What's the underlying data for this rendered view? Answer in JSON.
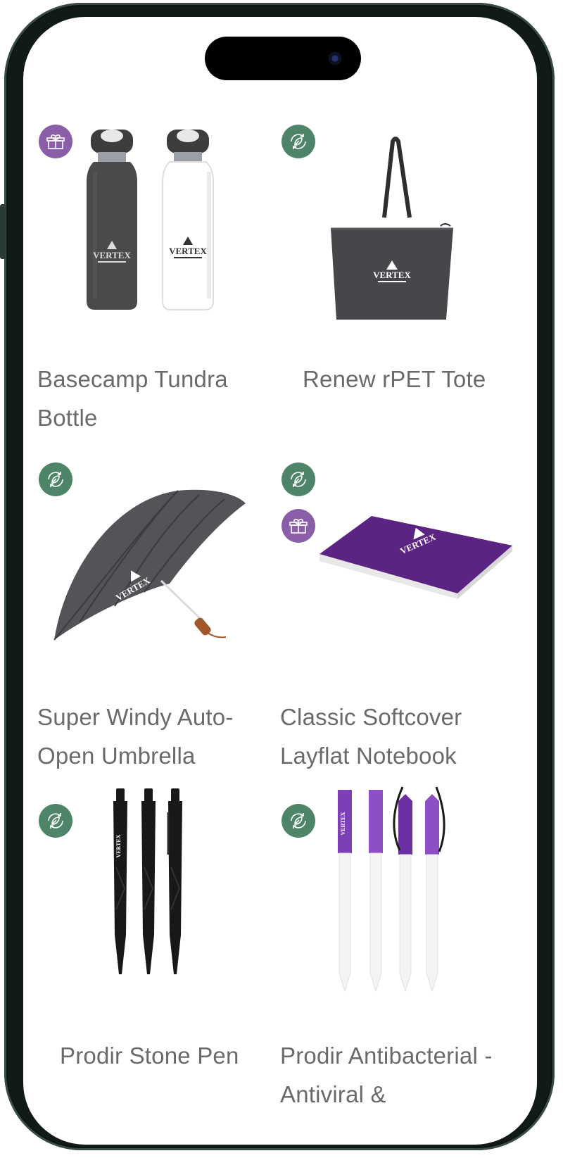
{
  "products": [
    {
      "name": "Basecamp Tundra Bottle",
      "brand": "VERTEX",
      "badges": [
        "gift"
      ]
    },
    {
      "name": "Renew rPET Tote",
      "brand": "VERTEX",
      "badges": [
        "eco"
      ]
    },
    {
      "name": "Super Windy Auto-Open Umbrella",
      "brand": "VERTEX",
      "badges": [
        "eco"
      ]
    },
    {
      "name": "Classic Softcover Layflat Notebook",
      "brand": "VERTEX",
      "badges": [
        "eco",
        "gift"
      ]
    },
    {
      "name": "Prodir Stone Pen",
      "brand": "VERTEX",
      "badges": [
        "eco"
      ]
    },
    {
      "name": "Prodir Antibacterial - Antiviral &",
      "brand": "VERTEX",
      "badges": [
        "eco"
      ]
    }
  ],
  "badge_types": {
    "eco": {
      "icon": "recycle-leaf-icon",
      "color": "#4e8568"
    },
    "gift": {
      "icon": "gift-box-icon",
      "color": "#8b5ea8"
    }
  },
  "colors": {
    "frame": "#0b1410",
    "text": "#6a6a6a",
    "notebook": "#5b2483",
    "charcoal": "#4a4a4d"
  }
}
